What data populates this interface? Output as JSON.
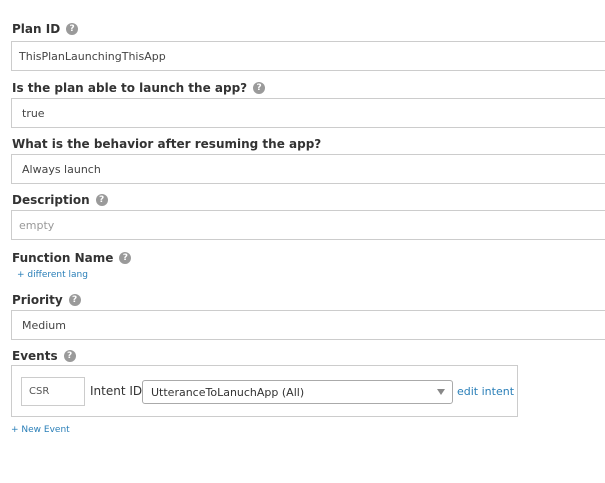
{
  "fields": {
    "plan_id": {
      "label": "Plan ID",
      "value": "ThisPlanLaunchingThisApp",
      "help_icon": "question-circle-icon"
    },
    "launch": {
      "label": "Is the plan able to launch the app?",
      "value": "true",
      "help_icon": "question-circle-icon"
    },
    "behavior": {
      "label": "What is the behavior after resuming the app?",
      "value": "Always launch"
    },
    "description": {
      "label": "Description",
      "placeholder": "empty",
      "help_icon": "question-circle-icon"
    },
    "function_name": {
      "label": "Function Name",
      "link": "+ different lang",
      "help_icon": "question-circle-icon"
    },
    "priority": {
      "label": "Priority",
      "value": "Medium",
      "help_icon": "question-circle-icon"
    },
    "events": {
      "label": "Events",
      "help_icon": "question-circle-icon",
      "csr_value": "CSR",
      "intent_label": "Intent ID",
      "intent_selected": "UtteranceToLanuchApp (All)",
      "edit_intent": "edit intent",
      "new_event": "+ New Event"
    }
  },
  "help_glyph": "?",
  "colors": {
    "link": "#2a7fb8",
    "border": "#cccccc",
    "help": "#9a9a9a"
  }
}
